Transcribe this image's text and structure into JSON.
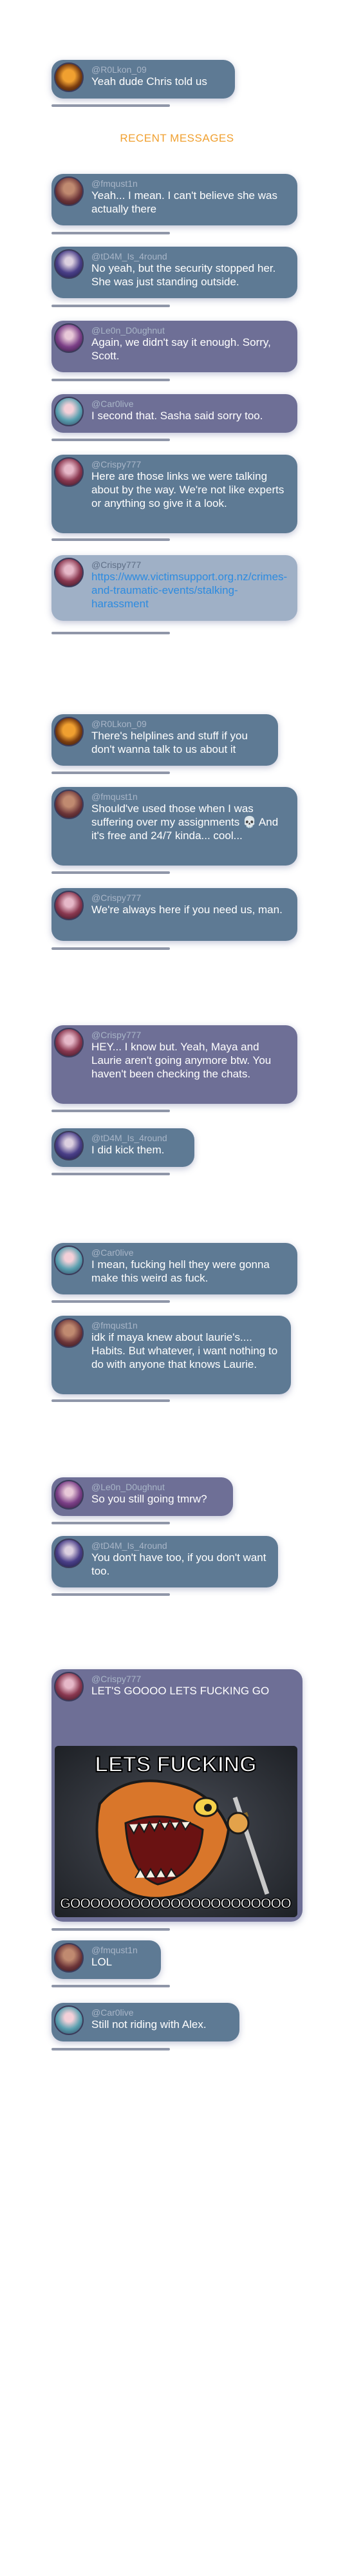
{
  "section_header": "RECENT MESSAGES",
  "messages": [
    {
      "user": "@R0Lkon_09",
      "text": "Yeah dude Chris told us"
    },
    {
      "user": "@fmqust1n",
      "text": "Yeah... I mean. I can't believe she was actually there"
    },
    {
      "user": "@tD4M_Is_4round",
      "text": "No yeah, but the security stopped her. She was just standing outside."
    },
    {
      "user": "@Le0n_D0ughnut",
      "text": "Again, we didn't say it enough. Sorry, Scott."
    },
    {
      "user": "@Car0live",
      "text": "I second that. Sasha said sorry too."
    },
    {
      "user": "@Crispy777",
      "text": "Here are those links we were talking about by the way. We're not like experts or anything so give it a look."
    },
    {
      "user": "@Crispy777",
      "text": "https://www.victimsupport.org.nz/crimes-and-traumatic-events/stalking-harassment"
    },
    {
      "user": "@R0Lkon_09",
      "text": "There's helplines and stuff if you don't wanna talk to us about it"
    },
    {
      "user": "@fmqust1n",
      "text": "Should've used those when I was suffering over my assignments 💀 And it's free and 24/7 kinda... cool..."
    },
    {
      "user": "@Crispy777",
      "text": "We're always here if you need us, man."
    },
    {
      "user": "@Crispy777",
      "text": "HEY... I know but. Yeah, Maya and Laurie aren't going anymore btw. You haven't been checking the chats."
    },
    {
      "user": "@tD4M_Is_4round",
      "text": "I did kick them."
    },
    {
      "user": "@Car0live",
      "text": "I mean, fucking hell they were gonna make this weird as fuck."
    },
    {
      "user": "@fmqust1n",
      "text": "idk if maya knew about laurie's.... Habits. But whatever, i want nothing to do with anyone that knows Laurie."
    },
    {
      "user": "@Le0n_D0ughnut",
      "text": "So you still going tmrw?"
    },
    {
      "user": "@tD4M_Is_4round",
      "text": "You don't have too, if you don't want too."
    },
    {
      "user": "@Crispy777",
      "text": "LET'S GOOOO LETS FUCKING GO"
    },
    {
      "user": "@fmqust1n",
      "text": "LOL"
    },
    {
      "user": "@Car0live",
      "text": "Still not riding with Alex."
    }
  ],
  "meme": {
    "top_text": "LETS FUCKING",
    "bottom_text": "GOOOOOOOOOOOOOOOOOOOOOO"
  },
  "colors": {
    "accent": "#f0a030",
    "bubble_blue": "#5e7a94",
    "bubble_purple": "#6e6f96",
    "link": "#2d8be0"
  }
}
